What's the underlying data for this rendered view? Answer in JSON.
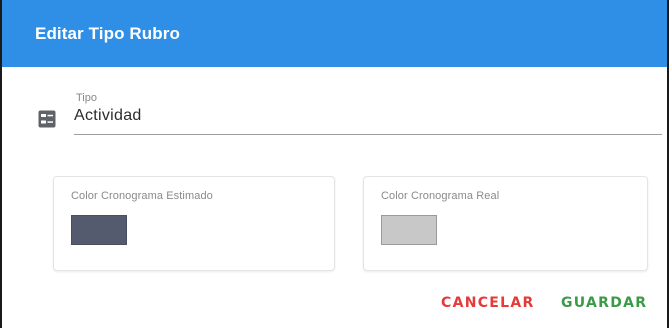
{
  "dialog": {
    "title": "Editar Tipo Rubro"
  },
  "tipo_field": {
    "label": "Tipo",
    "value": "Actividad",
    "icon": "list-alt-icon"
  },
  "colors": {
    "estimado": {
      "label": "Color Cronograma Estimado",
      "value": "#555b6e"
    },
    "real": {
      "label": "Color Cronograma Real",
      "value": "#c8c8c8"
    }
  },
  "actions": {
    "cancel_label": "CANCELAR",
    "save_label": "GUARDAR",
    "cancel_color": "#e53a3a",
    "save_color": "#3a9b46"
  },
  "theme": {
    "header_color": "#2f8fe6"
  }
}
